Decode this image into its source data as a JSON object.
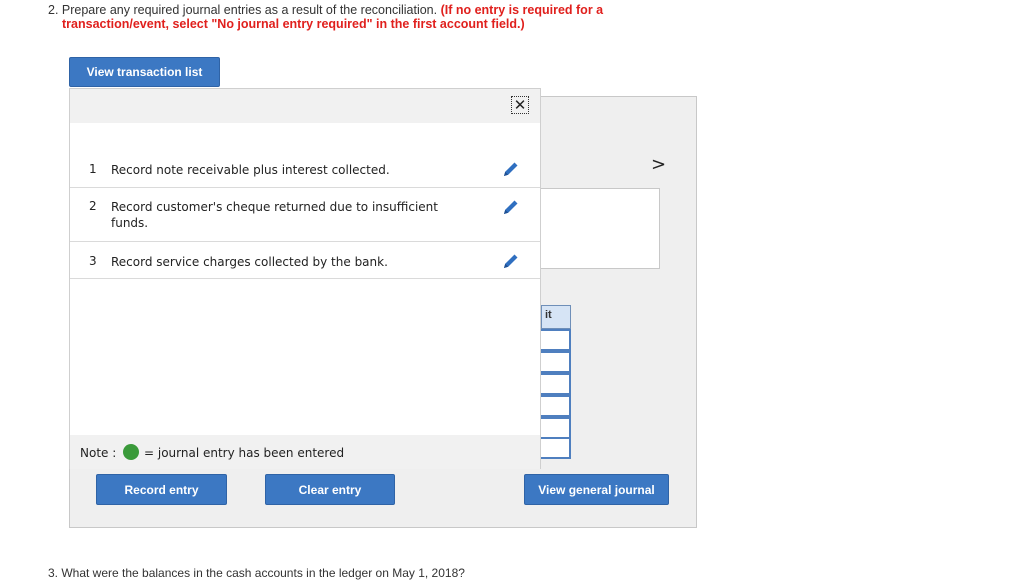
{
  "question2": {
    "prefix": "2. Prepare any required journal entries as a result of the reconciliation. ",
    "instruction_line1": "(If no entry is required for a",
    "instruction_line2": "transaction/event, select \"No journal entry required\" in the first account field.)"
  },
  "view_transaction_list_label": "View transaction list",
  "overlay": {
    "close_symbol": "✕",
    "transactions": [
      {
        "number": "1",
        "text": "Record note receivable plus interest collected."
      },
      {
        "number": "2",
        "text": "Record customer's cheque returned due to insufficient funds."
      },
      {
        "number": "3",
        "text": "Record service charges collected by the bank."
      }
    ],
    "note_label": "Note :",
    "note_text": "= journal entry has been entered"
  },
  "background": {
    "chevron": ">",
    "column_header_fragment": "it"
  },
  "buttons": {
    "record_entry": "Record entry",
    "clear_entry": "Clear entry",
    "view_general_journal": "View general journal"
  },
  "question3": "3. What were the balances in the cash accounts in the ledger on May 1, 2018?",
  "colors": {
    "button_blue": "#3c78c3",
    "instruction_red": "#e0201d",
    "entered_green": "#3a9a3a"
  }
}
